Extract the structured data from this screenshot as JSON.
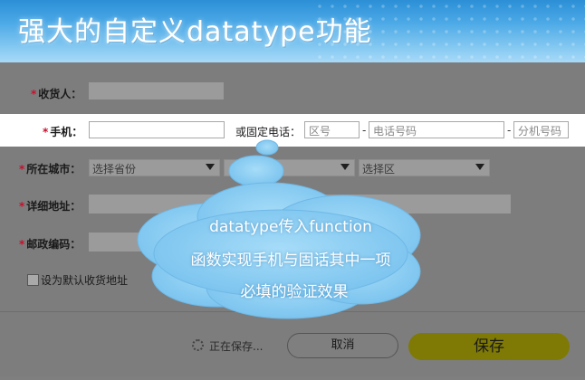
{
  "banner": {
    "title": "强大的自定义datatype功能"
  },
  "form": {
    "receiver_label": "收货人：",
    "phone_label": "手机：",
    "landline_label": "或固定电话：",
    "area_placeholder": "区号",
    "tel_placeholder": "电话号码",
    "ext_placeholder": "分机号码",
    "city_label": "所在城市：",
    "province_select": "选择省份",
    "district_select": "选择区",
    "address_label": "详细地址：",
    "postcode_label": "邮政编码：",
    "default_checkbox": "设为默认收货地址",
    "required_mark": "*",
    "dash": "-"
  },
  "footer": {
    "saving": "正在保存...",
    "cancel": "取消",
    "save": "保存"
  },
  "tooltip": {
    "line1": "datatype传入function",
    "line2": "函数实现手机与固话其中一项",
    "line3": "必填的验证效果"
  },
  "colors": {
    "banner_blue": "#2c8fd6",
    "save_button": "#7f7a05",
    "required": "#c8102e",
    "cloud": "#8fd0f5"
  }
}
